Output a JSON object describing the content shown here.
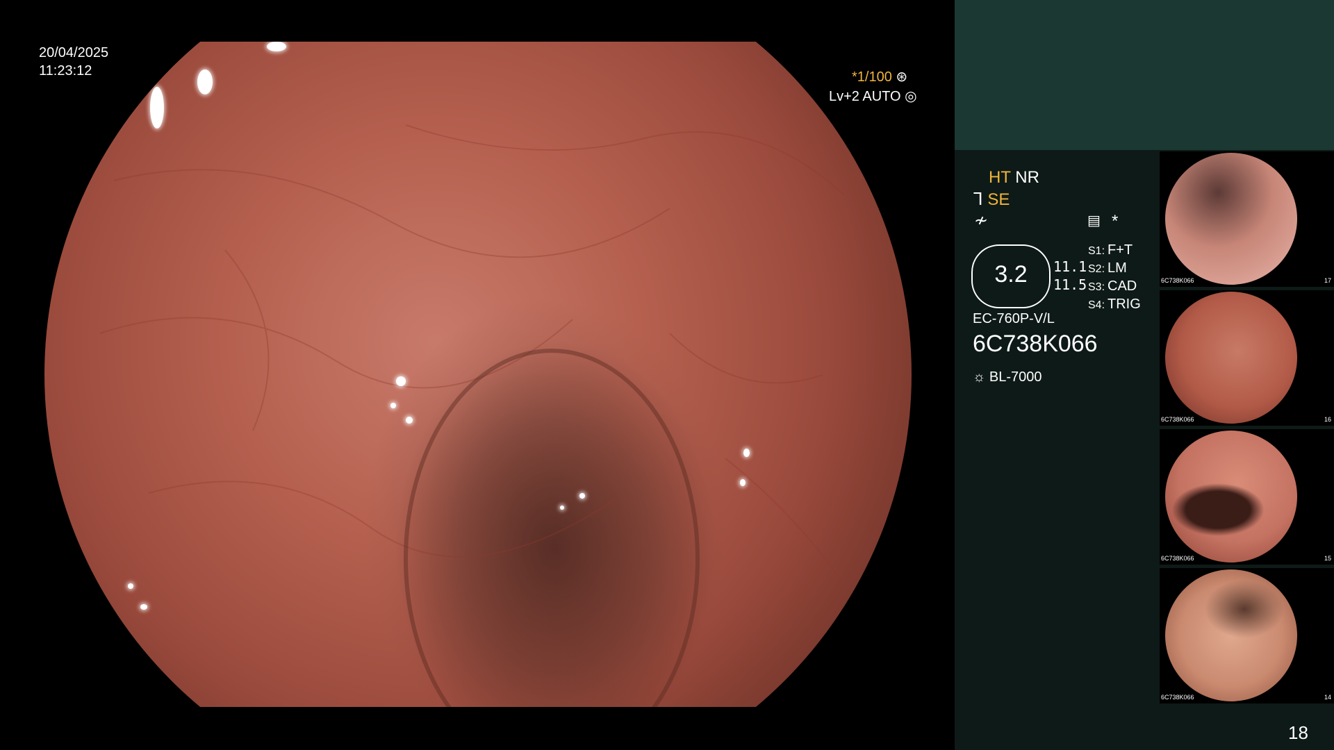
{
  "overlay": {
    "date": "20/04/2025",
    "time": "11:23:12",
    "shutter": "*1/100",
    "level": "Lv+2 AUTO"
  },
  "panel": {
    "ht": "HT",
    "nr": "NR",
    "se": "SE",
    "star": "*",
    "zoom": "3.2",
    "value_1": "11.1",
    "value_2": "11.5",
    "settings": [
      {
        "label": "S1:",
        "value": "F+T"
      },
      {
        "label": "S2:",
        "value": "LM"
      },
      {
        "label": "S3:",
        "value": "CAD"
      },
      {
        "label": "S4:",
        "value": "TRIG"
      }
    ],
    "scope_model": "EC-760P-V/L",
    "serial": "6C738K066",
    "light_source": "BL-7000",
    "page_number": "18"
  },
  "thumbnails": [
    {
      "caption": "6C738K066",
      "number": "17",
      "color": "#c68577"
    },
    {
      "caption": "6C738K066",
      "number": "16",
      "color": "#b25a48"
    },
    {
      "caption": "6C738K066",
      "number": "15",
      "color": "#c47262"
    },
    {
      "caption": "6C738K066",
      "number": "14",
      "color": "#c98a70"
    }
  ]
}
